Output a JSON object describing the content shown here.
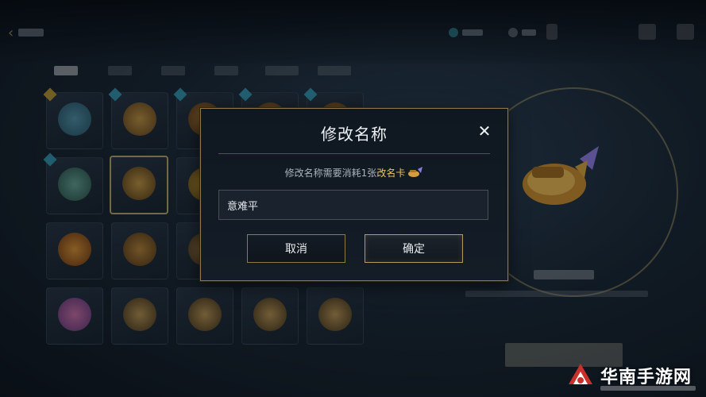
{
  "dialog": {
    "title": "修改名称",
    "close_glyph": "✕",
    "note_prefix": "修改名称需要消耗1张",
    "note_highlight": "改名卡",
    "input_value": "意难平",
    "cancel_label": "取消",
    "confirm_label": "确定"
  },
  "watermark": {
    "text": "华南手游网"
  },
  "colors": {
    "accent_gold": "#e7c46a",
    "dialog_border": "#8d7a48",
    "gem_blue": "#39b6d6"
  },
  "icons": {
    "back": "chevron-left-icon",
    "close": "close-icon",
    "card": "rename-card-icon"
  }
}
